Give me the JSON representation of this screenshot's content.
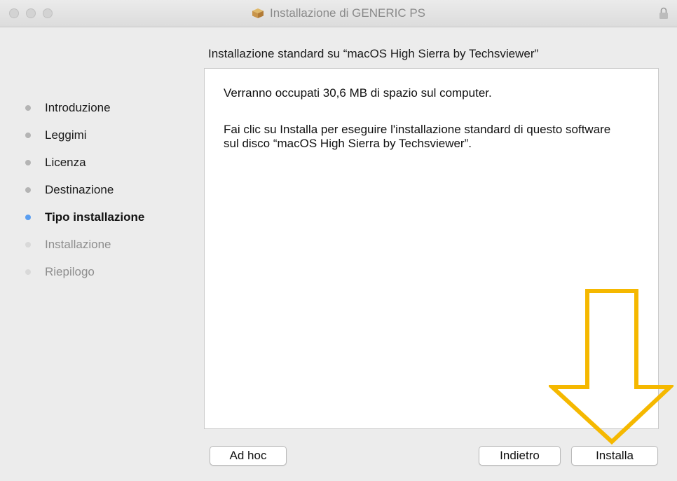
{
  "window": {
    "title": "Installazione di GENERIC PS",
    "title_icon": "package-icon",
    "lock_icon": "lock-icon"
  },
  "heading": "Installazione standard su “macOS High Sierra by Techsviewer”",
  "sidebar": {
    "items": [
      {
        "label": "Introduzione",
        "state": "done"
      },
      {
        "label": "Leggimi",
        "state": "done"
      },
      {
        "label": "Licenza",
        "state": "done"
      },
      {
        "label": "Destinazione",
        "state": "done"
      },
      {
        "label": "Tipo installazione",
        "state": "active"
      },
      {
        "label": "Installazione",
        "state": "pending"
      },
      {
        "label": "Riepilogo",
        "state": "pending"
      }
    ]
  },
  "content": {
    "line1": "Verranno occupati 30,6 MB di spazio sul computer.",
    "line2": "Fai clic su Installa per eseguire l'installazione standard di questo software sul disco “macOS High Sierra by Techsviewer”."
  },
  "buttons": {
    "adhoc": "Ad hoc",
    "back": "Indietro",
    "install": "Installa"
  },
  "colors": {
    "active_step_dot": "#5a9ef0",
    "annotation_arrow": "#f5b800"
  }
}
